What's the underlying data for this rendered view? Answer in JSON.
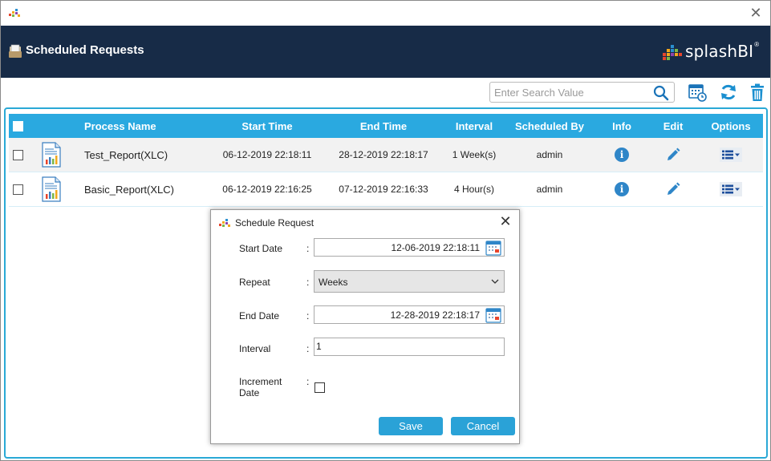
{
  "app": {
    "icon": "splashbi-logo-icon"
  },
  "header": {
    "title": "Scheduled Requests",
    "icon": "scheduled-requests-icon",
    "brand": {
      "name": "splashBI",
      "registered": "®"
    }
  },
  "toolbar": {
    "search_placeholder": "Enter Search Value",
    "search_value": "",
    "buttons": [
      "calendar-schedule-icon",
      "refresh-icon",
      "trash-icon"
    ]
  },
  "grid": {
    "columns": {
      "process_name": "Process Name",
      "start_time": "Start Time",
      "end_time": "End Time",
      "interval": "Interval",
      "scheduled_by": "Scheduled By",
      "info": "Info",
      "edit": "Edit",
      "options": "Options"
    },
    "rows": [
      {
        "process_name": "Test_Report(XLC)",
        "start_time": "06-12-2019 22:18:11",
        "end_time": "28-12-2019 22:18:17",
        "interval": "1 Week(s)",
        "scheduled_by": "admin",
        "info_glyph": "i"
      },
      {
        "process_name": "Basic_Report(XLC)",
        "start_time": "06-12-2019 22:16:25",
        "end_time": "07-12-2019 22:16:33",
        "interval": "4 Hour(s)",
        "scheduled_by": "admin",
        "info_glyph": "i"
      }
    ]
  },
  "dialog": {
    "title": "Schedule Request",
    "start_date": {
      "label": "Start Date",
      "value": "12-06-2019 22:18:11"
    },
    "repeat": {
      "label": "Repeat",
      "value": "Weeks"
    },
    "end_date": {
      "label": "End Date",
      "value": "12-28-2019 22:18:17"
    },
    "interval": {
      "label": "Interval",
      "value": "1"
    },
    "increment_date": {
      "label_line1": "Increment",
      "label_line2": "Date",
      "checked": false
    },
    "colon": ":",
    "save_label": "Save",
    "cancel_label": "Cancel"
  },
  "colors": {
    "header_bg": "#172b47",
    "accent": "#2aa9e0",
    "button": "#2aa2d7",
    "info_icon": "#2f86c8"
  }
}
